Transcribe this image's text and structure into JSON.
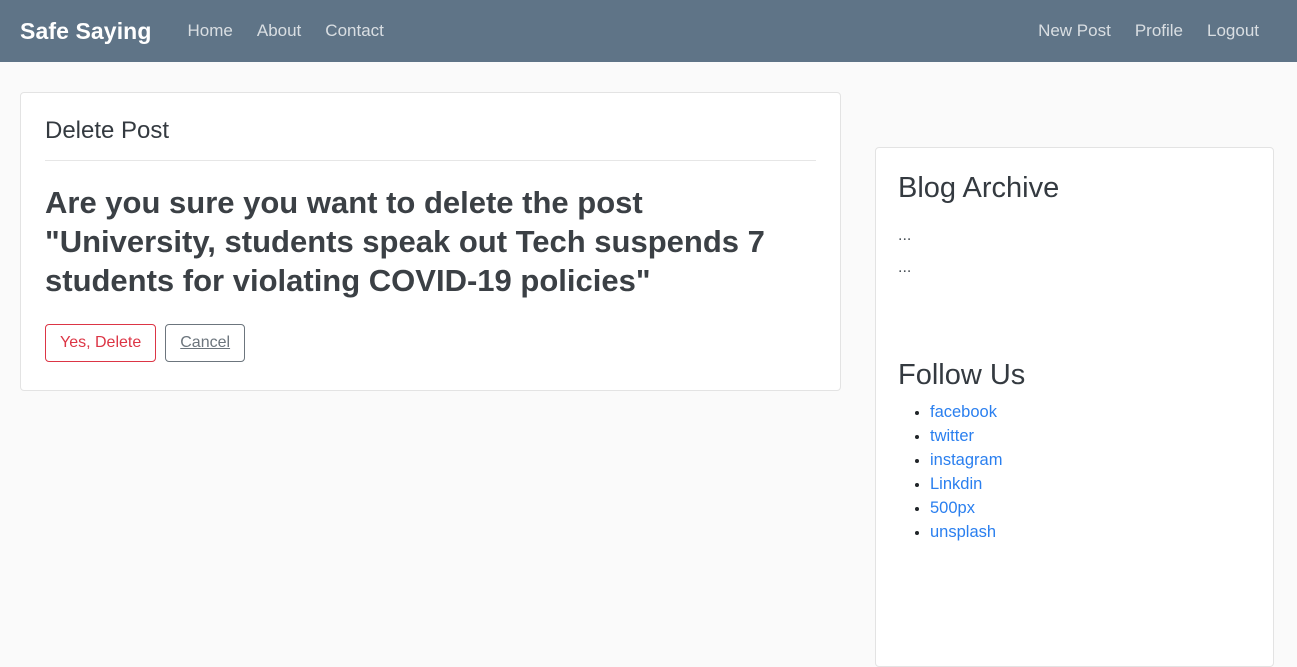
{
  "navbar": {
    "brand": "Safe Saying",
    "brand_color": "#ffffff",
    "background_color": "#5f7487",
    "left_links": [
      {
        "label": "Home",
        "name": "nav-link-home"
      },
      {
        "label": "About",
        "name": "nav-link-about"
      },
      {
        "label": "Contact",
        "name": "nav-link-contact"
      }
    ],
    "right_links": [
      {
        "label": "New Post",
        "name": "nav-link-new-post"
      },
      {
        "label": "Profile",
        "name": "nav-link-profile"
      },
      {
        "label": "Logout",
        "name": "nav-link-logout"
      }
    ]
  },
  "main": {
    "legend": "Delete Post",
    "confirm_text": "Are you sure you want to delete the post \"University, students speak out Tech suspends 7 students for violating COVID-19 policies\"",
    "post_title": "University, students speak out Tech suspends 7 students for violating COVID-19 policies",
    "buttons": {
      "confirm_label": "Yes, Delete",
      "confirm_color": "#dc3545",
      "cancel_label": "Cancel",
      "cancel_color": "#6c757d"
    }
  },
  "sidebar": {
    "archive_title": "Blog Archive",
    "archive_items": [
      "...",
      "..."
    ],
    "follow_title": "Follow Us",
    "social_links": [
      {
        "label": "facebook",
        "name": "social-link-facebook"
      },
      {
        "label": "twitter",
        "name": "social-link-twitter"
      },
      {
        "label": "instagram",
        "name": "social-link-instagram"
      },
      {
        "label": "Linkdin",
        "name": "social-link-linkdin"
      },
      {
        "label": "500px",
        "name": "social-link-500px"
      },
      {
        "label": "unsplash",
        "name": "social-link-unsplash"
      }
    ],
    "link_color": "#2a7fef"
  }
}
